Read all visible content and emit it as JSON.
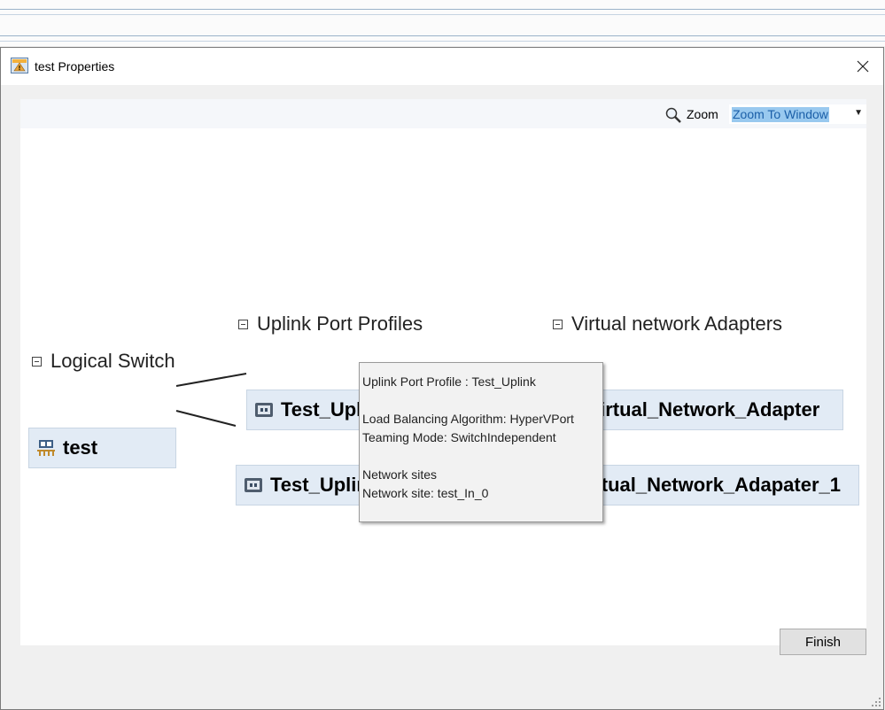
{
  "window": {
    "title": "test Properties"
  },
  "toolbar": {
    "zoom_label": "Zoom",
    "zoom_value": "Zoom To Window"
  },
  "groups": {
    "logical_switch": "Logical Switch",
    "uplink_port_profiles": "Uplink Port Profiles",
    "virtual_network_adapters": "Virtual network Adapters"
  },
  "nodes": {
    "switch": "test",
    "uplink_1": "Test_Uplink",
    "uplink_2": "Test_Uplink",
    "vna_1": "Test_Virtual_Network_Adapter",
    "vna_2": "Test_Virtual_Network_Adapater_1"
  },
  "tooltip": {
    "line1": "Uplink Port Profile : Test_Uplink",
    "line2": "Load Balancing Algorithm: HyperVPort",
    "line3": "Teaming Mode: SwitchIndependent",
    "line4": "Network sites",
    "line5": "Network site: test_In_0"
  },
  "footer": {
    "finish_label": "Finish"
  },
  "colors": {
    "node_fill": "#e2ebf5",
    "selection": "#99c9ef"
  }
}
